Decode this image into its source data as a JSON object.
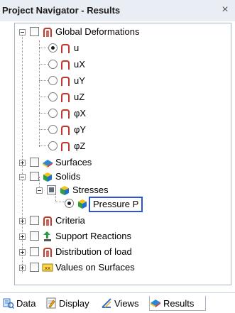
{
  "panel": {
    "title": "Project Navigator - Results",
    "close": "×"
  },
  "tree": {
    "global_deformations": "Global Deformations",
    "u": "u",
    "ux": "uX",
    "uy": "uY",
    "uz": "uZ",
    "phix": "φX",
    "phiy": "φY",
    "phiz": "φZ",
    "surfaces": "Surfaces",
    "solids": "Solids",
    "stresses": "Stresses",
    "pressure": "Pressure P",
    "criteria": "Criteria",
    "support_reactions": "Support Reactions",
    "distribution_of_load": "Distribution of load",
    "values_on_surfaces": "Values on Surfaces"
  },
  "tabs": {
    "data": "Data",
    "display": "Display",
    "views": "Views",
    "results": "Results",
    "active": "results"
  },
  "colors": {
    "accent_border": "#2b55d6",
    "title_bar": "#e9eef5"
  }
}
